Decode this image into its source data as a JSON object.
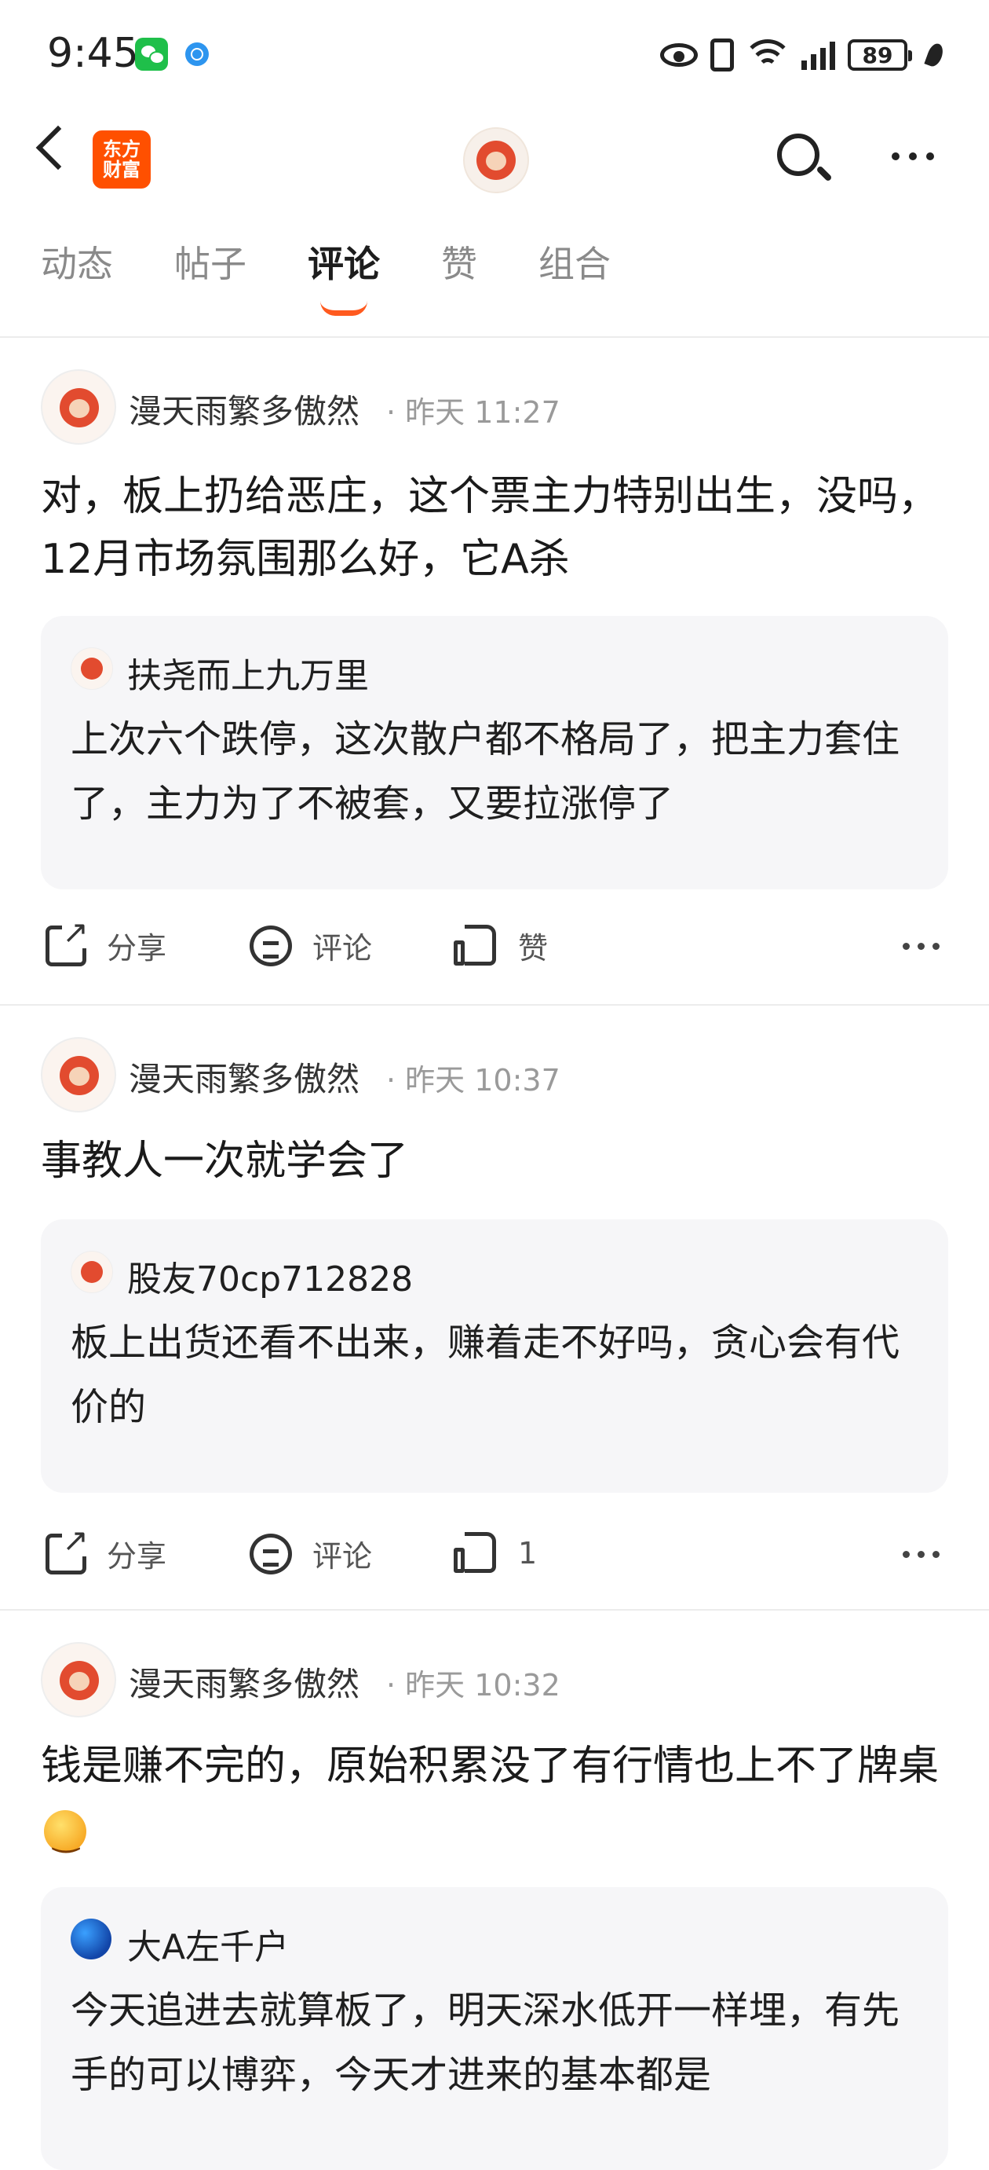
{
  "status_bar": {
    "time": "9:45",
    "battery": "89"
  },
  "header": {
    "logo_line1": "东方",
    "logo_line2": "财富"
  },
  "tabs": [
    {
      "label": "动态"
    },
    {
      "label": "帖子"
    },
    {
      "label": "评论"
    },
    {
      "label": "赞"
    },
    {
      "label": "组合"
    }
  ],
  "active_tab": "评论",
  "posts": [
    {
      "author": "漫天雨繁多傲然",
      "time": "· 昨天 11:27",
      "content": "对，板上扔给恶庄，这个票主力特别出生，没吗，12月市场氛围那么好，它A杀",
      "quote": {
        "author": "扶尧而上九万里",
        "text": "上次六个跌停，这次散户都不格局了，把主力套住了，主力为了不被套，又要拉涨停了"
      },
      "actions": {
        "share": "分享",
        "comment": "评论",
        "like": "赞"
      }
    },
    {
      "author": "漫天雨繁多傲然",
      "time": "· 昨天 10:37",
      "content": "事教人一次就学会了",
      "quote": {
        "author": "股友70cp712828",
        "text": "板上出货还看不出来，赚着走不好吗，贪心会有代价的"
      },
      "actions": {
        "share": "分享",
        "comment": "评论",
        "like": "1"
      }
    },
    {
      "author": "漫天雨繁多傲然",
      "time": "· 昨天 10:32",
      "content": "钱是赚不完的，原始积累没了有行情也上不了牌桌",
      "emoji": "smile-emoji",
      "quote": {
        "author": "大A左千户",
        "text": "今天追进去就算板了，明天深水低开一样埋，有先手的可以博弈，今天才进来的基本都是"
      }
    }
  ],
  "colors": {
    "accent": "#ff5a1f",
    "brand": "#ff5000",
    "quote_bg": "#f6f6f8"
  }
}
